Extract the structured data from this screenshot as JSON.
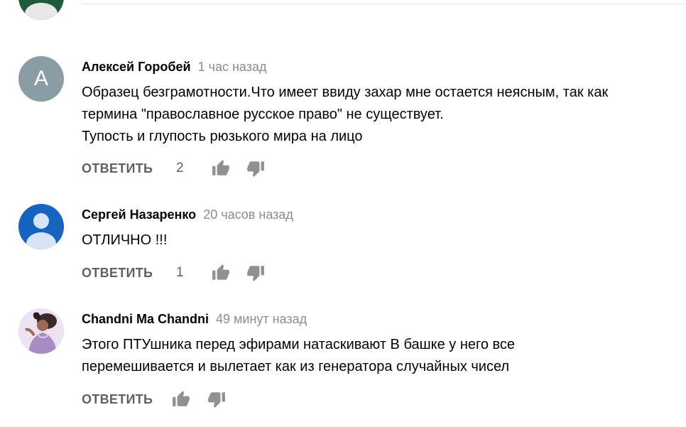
{
  "comments": [
    {
      "author": "Алексей Горобей",
      "time": "1 час назад",
      "avatar_letter": "A",
      "avatar_color": "#8a9ca5",
      "lines": [
        "Образец безграмотности.Что имеет ввиду захар мне остается неясным, так как",
        "термина \"православное русское право\" не существует.",
        "Тупость и глупость рюзького мира на лицо"
      ],
      "reply_label": "ОТВЕТИТЬ",
      "likes": "2"
    },
    {
      "author": "Сергей Назаренко",
      "time": "20 часов назад",
      "avatar_color": "#1565c0",
      "lines": [
        "ОТЛИЧНО !!!"
      ],
      "reply_label": "ОТВЕТИТЬ",
      "likes": "1"
    },
    {
      "author": "Chandni Ma Chandni",
      "time": "49 минут назад",
      "lines": [
        "Этого ПТУшника перед эфирами натаскивают В башке у него все",
        "перемешивается и вылетает как из генератора случайных чисел"
      ],
      "reply_label": "ОТВЕТИТЬ"
    }
  ],
  "icons": {
    "like": "thumb-up-icon",
    "dislike": "thumb-down-icon"
  },
  "colors": {
    "secondary_text": "#606060",
    "timestamp": "#8c8c8c"
  }
}
